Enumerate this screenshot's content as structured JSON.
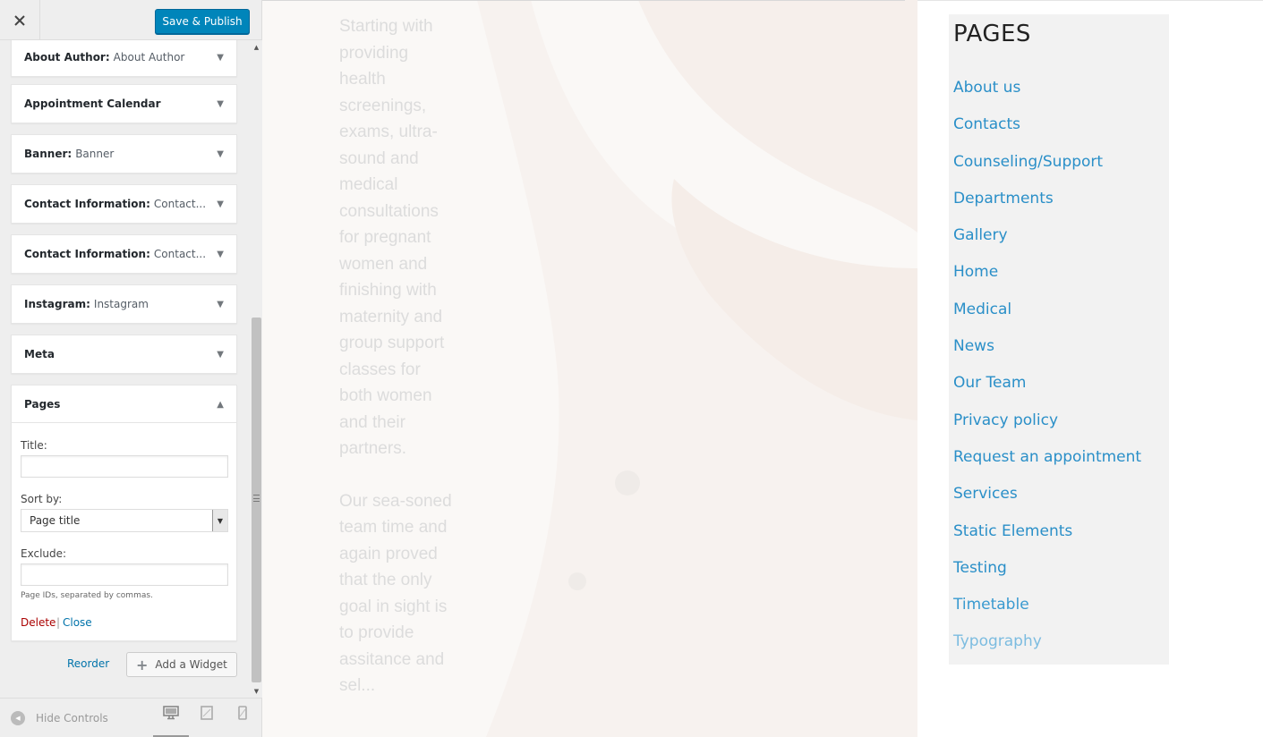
{
  "customizer": {
    "save_label": "Save & Publish",
    "widgets": [
      {
        "title": "About Author",
        "subtitle": "About Author"
      },
      {
        "title": "Appointment Calendar",
        "subtitle": ""
      },
      {
        "title": "Banner",
        "subtitle": "Banner"
      },
      {
        "title": "Contact Information",
        "subtitle": "Contact..."
      },
      {
        "title": "Contact Information",
        "subtitle": "Contact..."
      },
      {
        "title": "Instagram",
        "subtitle": "Instagram"
      },
      {
        "title": "Meta",
        "subtitle": ""
      }
    ],
    "pages_widget": {
      "title": "Pages",
      "title_label": "Title:",
      "title_value": "",
      "sort_label": "Sort by:",
      "sort_value": "Page title",
      "exclude_label": "Exclude:",
      "exclude_value": "",
      "exclude_hint": "Page IDs, separated by commas.",
      "delete_label": "Delete",
      "separator": "|",
      "close_label": "Close"
    },
    "reorder_label": "Reorder",
    "add_widget_label": "Add a Widget",
    "hide_controls_label": "Hide Controls"
  },
  "preview": {
    "hero_paragraphs": [
      "Starting with providing health screenings, exams, ultra-sound and medical consultations for pregnant women and finishing with maternity and group support classes for both women and their partners.",
      "Our sea-soned team time and again proved that the only goal in sight is to provide assitance and sel..."
    ],
    "sidebar_heading": "PAGES",
    "pages": [
      "About us",
      "Contacts",
      "Counseling/Support",
      "Departments",
      "Gallery",
      "Home",
      "Medical",
      "News",
      "Our Team",
      "Privacy policy",
      "Request an appointment",
      "Services",
      "Static Elements",
      "Testing",
      "Timetable",
      "Typography"
    ]
  },
  "colors": {
    "primary_button": "#0085ba",
    "link": "#0073aa",
    "delete": "#a00000",
    "page_link": "#2a8fc8"
  },
  "icons": {
    "close": "close-icon",
    "collapse": "arrow-down-icon",
    "expand": "arrow-up-icon",
    "add": "plus-icon",
    "hide_controls": "collapse-arrow-icon",
    "desktop": "desktop-icon",
    "tablet": "tablet-icon",
    "mobile": "mobile-icon"
  }
}
